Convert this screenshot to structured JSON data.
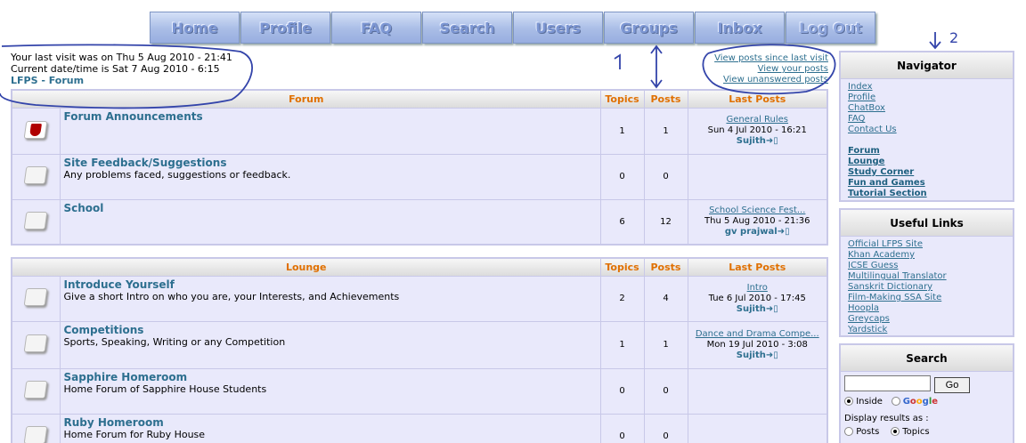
{
  "nav": [
    "Home",
    "Profile",
    "FAQ",
    "Search",
    "Users",
    "Groups",
    "Inbox",
    "Log Out"
  ],
  "info": {
    "last_visit": "Your last visit was on Thu 5 Aug 2010 - 21:41",
    "current": "Current date/time is Sat 7 Aug 2010 - 6:15",
    "forum_link": "LFPS - Forum"
  },
  "quick": [
    "View posts since last visit",
    "View your posts",
    "View unanswered posts"
  ],
  "annotations": {
    "one": "1",
    "two": "2"
  },
  "table1": {
    "headers": [
      "Forum",
      "Topics",
      "Posts",
      "Last Posts"
    ],
    "rows": [
      {
        "title": "Forum Announcements",
        "desc": "",
        "topics": "1",
        "posts": "1",
        "lp_title": "General Rules",
        "lp_date": "Sun 4 Jul 2010 - 16:21",
        "lp_user": "Sujith"
      },
      {
        "title": "Site Feedback/Suggestions",
        "desc": "Any problems faced, suggestions or feedback.",
        "topics": "0",
        "posts": "0",
        "lp_title": "",
        "lp_date": "",
        "lp_user": ""
      },
      {
        "title": "School",
        "desc": "",
        "topics": "6",
        "posts": "12",
        "lp_title": "School Science Fest...",
        "lp_date": "Thu 5 Aug 2010 - 21:36",
        "lp_user": "gv prajwal"
      }
    ]
  },
  "table2": {
    "headers": [
      "Lounge",
      "Topics",
      "Posts",
      "Last Posts"
    ],
    "rows": [
      {
        "title": "Introduce Yourself",
        "desc": "Give a short Intro on who you are, your Interests, and Achievements",
        "topics": "2",
        "posts": "4",
        "lp_title": "Intro",
        "lp_date": "Tue 6 Jul 2010 - 17:45",
        "lp_user": "Sujith"
      },
      {
        "title": "Competitions",
        "desc": "Sports, Speaking, Writing or any Competition",
        "topics": "1",
        "posts": "1",
        "lp_title": "Dance and Drama Compe...",
        "lp_date": "Mon 19 Jul 2010 - 3:08",
        "lp_user": "Sujith"
      },
      {
        "title": "Sapphire Homeroom",
        "desc": "Home Forum of Sapphire House Students",
        "topics": "0",
        "posts": "0",
        "lp_title": "",
        "lp_date": "",
        "lp_user": ""
      },
      {
        "title": "Ruby Homeroom",
        "desc": "Home Forum for Ruby House",
        "topics": "0",
        "posts": "0",
        "lp_title": "",
        "lp_date": "",
        "lp_user": ""
      }
    ]
  },
  "navigator": {
    "title": "Navigator",
    "links": [
      "Index",
      "Profile",
      "ChatBox",
      "FAQ",
      "Contact Us"
    ],
    "bold_links": [
      "Forum",
      "Lounge",
      "Study Corner",
      "Fun and Games",
      "Tutorial Section"
    ]
  },
  "useful": {
    "title": "Useful Links",
    "links": [
      "Official LFPS Site",
      "Khan Academy",
      "ICSE Guess",
      "Multilingual Translator",
      "Sanskrit Dictionary",
      "Film-Making SSA Site",
      "Hoopla",
      "Greycaps",
      "Yardstick"
    ]
  },
  "search": {
    "title": "Search",
    "go": "Go",
    "inside": "Inside",
    "google": [
      "G",
      "o",
      "o",
      "g",
      "l",
      "e"
    ],
    "display": "Display results as :",
    "posts": "Posts",
    "topics": "Topics"
  }
}
